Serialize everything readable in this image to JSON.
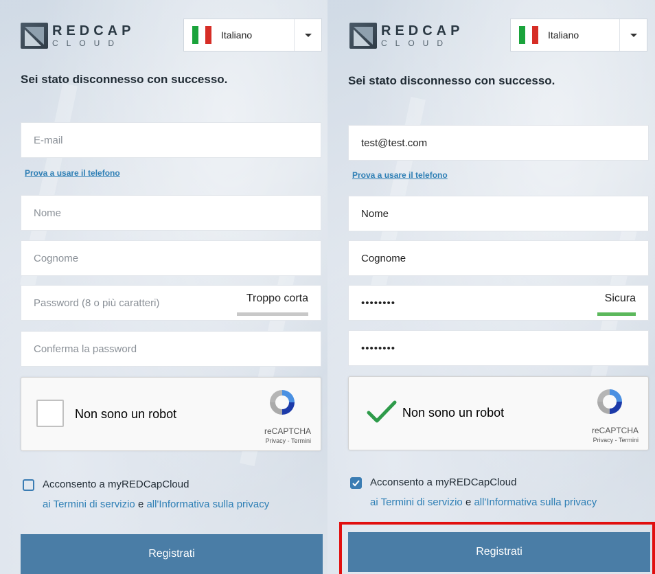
{
  "logo": {
    "top": "REDCAP",
    "bottom": "CLOUD"
  },
  "language": {
    "selected": "Italiano",
    "flag_colors": [
      "#1aa33b",
      "#ffffff",
      "#d62d26"
    ]
  },
  "heading": "Sei stato disconnesso con successo.",
  "phone_link": "Prova a usare il telefono",
  "captcha": {
    "label": "Non sono un robot",
    "brand": "reCAPTCHA",
    "links": "Privacy - Termini"
  },
  "consent": {
    "line1": "Acconsento a myREDCapCloud",
    "terms": "ai Termini di servizio",
    "and": "e",
    "privacy": "all'Informativa sulla privacy"
  },
  "submit_label": "Registrati",
  "left_form": {
    "email_placeholder": "E-mail",
    "first_name_placeholder": "Nome",
    "last_name_placeholder": "Cognome",
    "password_placeholder": "Password (8 o più caratteri)",
    "password_strength": "Troppo corta",
    "password_strength_color": "#c8c8c8",
    "confirm_placeholder": "Conferma la password",
    "captcha_checked": false,
    "consent_checked": false
  },
  "right_form": {
    "email_value": "test@test.com",
    "first_name_value": "Nome",
    "last_name_value": "Cognome",
    "password_value": "••••••••",
    "password_strength": "Sicura",
    "password_strength_color": "#5cb85c",
    "confirm_value": "••••••••",
    "captcha_checked": true,
    "consent_checked": true
  },
  "colors": {
    "accent": "#4a7da6",
    "link": "#2e7fb5",
    "highlight": "#e10f0f"
  }
}
